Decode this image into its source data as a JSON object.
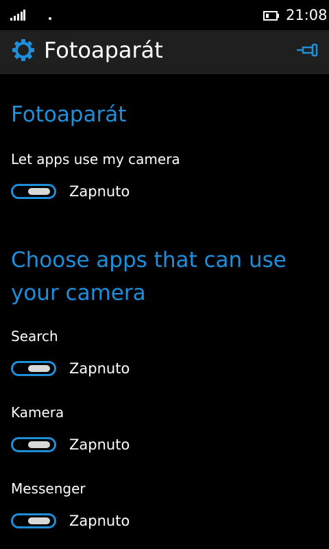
{
  "status_bar": {
    "time": "21:08",
    "signal_icon": "signal-bars-icon",
    "battery_icon": "battery-icon"
  },
  "header": {
    "icon": "gear-icon",
    "title": "Fotoaparát",
    "pin_icon": "pin-icon"
  },
  "camera_section": {
    "title": "Fotoaparát",
    "setting_label": "Let apps use my camera",
    "toggle_state": "Zapnuto",
    "toggle_on": true
  },
  "apps_section": {
    "title_line1": "Choose apps that can use",
    "title_line2": "your camera",
    "apps": [
      {
        "name": "Search",
        "toggle_state": "Zapnuto",
        "toggle_on": true
      },
      {
        "name": "Kamera",
        "toggle_state": "Zapnuto",
        "toggle_on": true
      },
      {
        "name": "Messenger",
        "toggle_state": "Zapnuto",
        "toggle_on": true
      }
    ]
  },
  "colors": {
    "accent": "#1e8fda",
    "header_bg": "#1f1f1f",
    "background": "#000000",
    "text": "#ffffff"
  }
}
